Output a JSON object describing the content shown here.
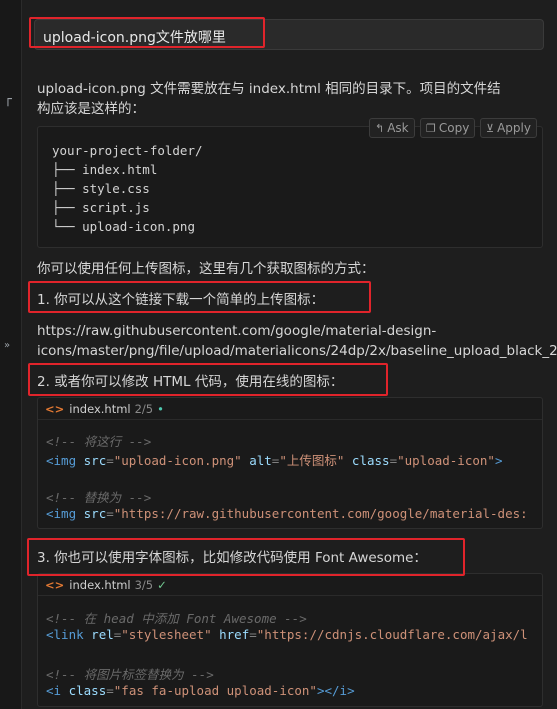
{
  "gutter": {
    "marks": [
      "┌",
      "»"
    ]
  },
  "user_message": {
    "text": "upload-icon.png文件放哪里"
  },
  "answer": {
    "intro_line1": "upload-icon.png 文件需要放在与 index.html 相同的目录下。项目的文件结",
    "intro_line2": "构应该是这样的：",
    "actions": {
      "ask": "Ask",
      "copy": "Copy",
      "apply": "Apply"
    },
    "tree": [
      "your-project-folder/",
      "├── index.html",
      "├── style.css",
      "├── script.js",
      "└── upload-icon.png"
    ],
    "methods_intro": "你可以使用任何上传图标，这里有几个获取图标的方式：",
    "method1": "1. 你可以从这个链接下载一个简单的上传图标：",
    "url_line1": "https://raw.githubusercontent.com/google/material-design-",
    "url_line2": "icons/master/png/file/upload/materialicons/24dp/2x/baseline_upload_black_2",
    "method2": "2. 或者你可以修改 HTML 代码，使用在线的图标：",
    "code1": {
      "filename": "index.html",
      "count": "2/5",
      "status": "•",
      "comment1": "<!-- 将这行 -->",
      "line1": {
        "open": "<img",
        "attr1": "src",
        "val1": "\"upload-icon.png\"",
        "attr2": "alt",
        "val2": "\"上传图标\"",
        "attr3": "class",
        "val3": "\"upload-icon\"",
        "close": ">"
      },
      "comment2": "<!-- 替换为 -->",
      "line2": {
        "open": "<img",
        "attr1": "src",
        "val1": "\"https://raw.githubusercontent.com/google/material-des:"
      }
    },
    "method3": "3. 你也可以使用字体图标，比如修改代码使用 Font Awesome：",
    "code2": {
      "filename": "index.html",
      "count": "3/5",
      "status": "✓",
      "comment1": "<!-- 在 head 中添加 Font Awesome -->",
      "line1": {
        "open": "<link",
        "attr1": "rel",
        "val1": "\"stylesheet\"",
        "attr2": "href",
        "val2": "\"https://cdnjs.cloudflare.com/ajax/l"
      },
      "comment2": "<!-- 将图片标签替换为 -->",
      "line2": {
        "open": "<i",
        "attr1": "class",
        "val1": "\"fas fa-upload upload-icon\"",
        "mid": "></",
        "tag": "i",
        "close": ">"
      }
    }
  },
  "colors": {
    "highlight": "#e0242b",
    "background": "#1e1e1e"
  }
}
